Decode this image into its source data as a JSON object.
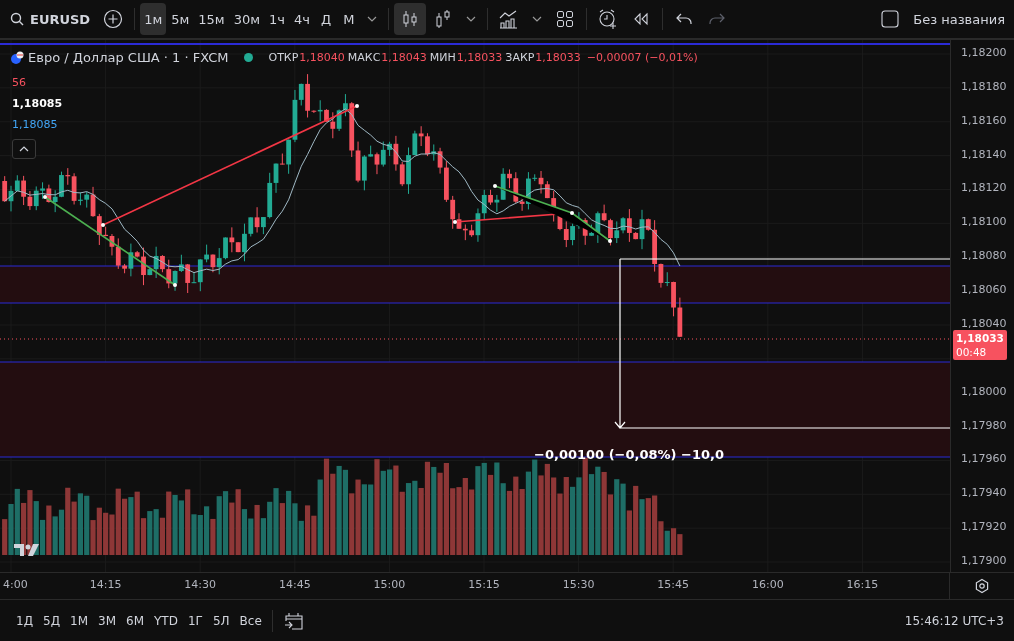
{
  "toolbar": {
    "symbol": "EURUSD",
    "intervals": [
      {
        "label": "1м",
        "selected": true
      },
      {
        "label": "5м",
        "selected": false
      },
      {
        "label": "15м",
        "selected": false
      },
      {
        "label": "30м",
        "selected": false
      },
      {
        "label": "1ч",
        "selected": false
      },
      {
        "label": "4ч",
        "selected": false
      },
      {
        "label": "Д",
        "selected": false
      },
      {
        "label": "М",
        "selected": false
      }
    ],
    "chart_type_buttons": [
      {
        "selected": true
      },
      {
        "selected": false
      }
    ],
    "undo": {
      "disabled": false
    },
    "redo": {
      "disabled": true
    },
    "layout_name": "Без названия"
  },
  "legend": {
    "title": "Евро / Доллар США · 1 · FXCM",
    "market_open": true,
    "values": [
      {
        "label": "ОТКР",
        "value": "1,18040"
      },
      {
        "label": "МАКС",
        "value": "1,18043"
      },
      {
        "label": "МИН",
        "value": "1,18033"
      },
      {
        "label": "ЗАКР",
        "value": "1,18033"
      }
    ],
    "change": "−0,00007 (−0,01%)"
  },
  "indicators": [
    {
      "value": "56",
      "color": "#f7525f"
    },
    {
      "value": "1,18085",
      "color": "#ffffff"
    },
    {
      "value": "1,18085",
      "color": "#42a5f5"
    }
  ],
  "price_axis": {
    "upper_ticks": [
      "1,18200",
      "1,18180",
      "1,18160",
      "1,18140",
      "1,18120",
      "1,18100",
      "1,18080",
      "1,18060",
      "1,18040"
    ],
    "lower_ticks": [
      "1,18000",
      "1,17980",
      "1,17960",
      "1,17940",
      "1,17920",
      "1,17900"
    ],
    "last_price": "1,18033",
    "countdown": "00:48"
  },
  "measure": {
    "label": "−0,00100 (−0,08%) −10,0"
  },
  "time_axis": [
    "4:00",
    "14:15",
    "14:30",
    "14:45",
    "15:00",
    "15:15",
    "15:30",
    "15:45",
    "16:00",
    "16:15"
  ],
  "bottom_bar": {
    "ranges": [
      "1Д",
      "5Д",
      "1М",
      "3М",
      "6М",
      "YTD",
      "1Г",
      "5Л",
      "Все"
    ],
    "clock": "15:46:12 UTC+3"
  }
}
